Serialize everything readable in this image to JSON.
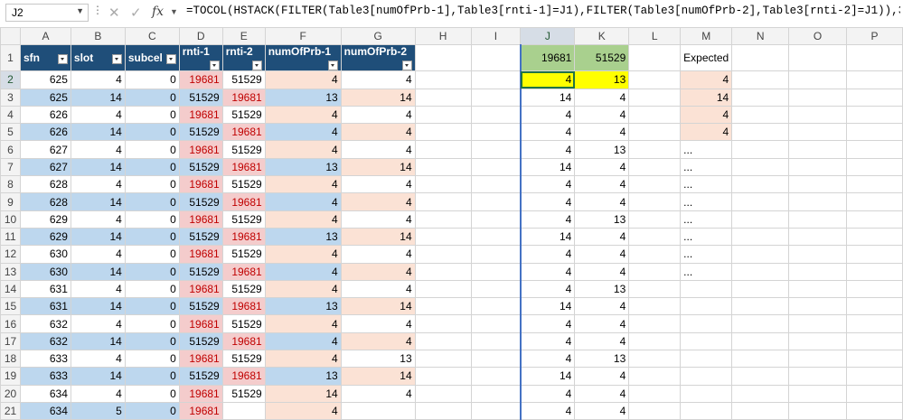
{
  "formula_bar": {
    "name_box": "J2",
    "formula": "=TOCOL(HSTACK(FILTER(Table3[numOfPrb-1],Table3[rnti-1]=J1),FILTER(Table3[numOfPrb-2],Table3[rnti-2]=J1)),3)"
  },
  "columns": [
    "A",
    "B",
    "C",
    "D",
    "E",
    "F",
    "G",
    "H",
    "I",
    "J",
    "K",
    "L",
    "M",
    "N",
    "O",
    "P"
  ],
  "table_headers": [
    "sfn",
    "slot",
    "subcel",
    "rnti-1",
    "rnti-2",
    "numOfPrb-1",
    "numOfPrb-2"
  ],
  "table_rows": [
    [
      "625",
      "4",
      "0",
      "19681",
      "51529",
      "4",
      "4"
    ],
    [
      "625",
      "14",
      "0",
      "51529",
      "19681",
      "13",
      "14"
    ],
    [
      "626",
      "4",
      "0",
      "19681",
      "51529",
      "4",
      "4"
    ],
    [
      "626",
      "14",
      "0",
      "51529",
      "19681",
      "4",
      "4"
    ],
    [
      "627",
      "4",
      "0",
      "19681",
      "51529",
      "4",
      "4"
    ],
    [
      "627",
      "14",
      "0",
      "51529",
      "19681",
      "13",
      "14"
    ],
    [
      "628",
      "4",
      "0",
      "19681",
      "51529",
      "4",
      "4"
    ],
    [
      "628",
      "14",
      "0",
      "51529",
      "19681",
      "4",
      "4"
    ],
    [
      "629",
      "4",
      "0",
      "19681",
      "51529",
      "4",
      "4"
    ],
    [
      "629",
      "14",
      "0",
      "51529",
      "19681",
      "13",
      "14"
    ],
    [
      "630",
      "4",
      "0",
      "19681",
      "51529",
      "4",
      "4"
    ],
    [
      "630",
      "14",
      "0",
      "51529",
      "19681",
      "4",
      "4"
    ],
    [
      "631",
      "4",
      "0",
      "19681",
      "51529",
      "4",
      "4"
    ],
    [
      "631",
      "14",
      "0",
      "51529",
      "19681",
      "13",
      "14"
    ],
    [
      "632",
      "4",
      "0",
      "19681",
      "51529",
      "4",
      "4"
    ],
    [
      "632",
      "14",
      "0",
      "51529",
      "19681",
      "4",
      "4"
    ],
    [
      "633",
      "4",
      "0",
      "19681",
      "51529",
      "4",
      "13"
    ],
    [
      "633",
      "14",
      "0",
      "51529",
      "19681",
      "13",
      "14"
    ],
    [
      "634",
      "4",
      "0",
      "19681",
      "51529",
      "14",
      "4"
    ],
    [
      "634",
      "5",
      "0",
      "19681",
      "",
      "4",
      ""
    ]
  ],
  "j_values": [
    "19681",
    "4",
    "14",
    "4",
    "4",
    "4",
    "14",
    "4",
    "4",
    "4",
    "14",
    "4",
    "4",
    "4",
    "14",
    "4",
    "4",
    "4",
    "14",
    "4",
    "4"
  ],
  "k_values": [
    "51529",
    "13",
    "4",
    "4",
    "4",
    "13",
    "4",
    "4",
    "4",
    "13",
    "4",
    "4",
    "4",
    "13",
    "4",
    "4",
    "4",
    "13",
    "4",
    "4",
    "4"
  ],
  "expected_label": "Expected",
  "expected_values": [
    "4",
    "14",
    "4",
    "4",
    "...",
    "...",
    "...",
    "...",
    "...",
    "...",
    "...",
    "..."
  ],
  "colors": {
    "header_blue": "#1f4e79",
    "band_blue": "#bdd7ee",
    "red_fill": "#f4cccc",
    "peach_fill": "#fbe2d5",
    "green": "#a9d08e",
    "yellow": "#ffff00"
  }
}
